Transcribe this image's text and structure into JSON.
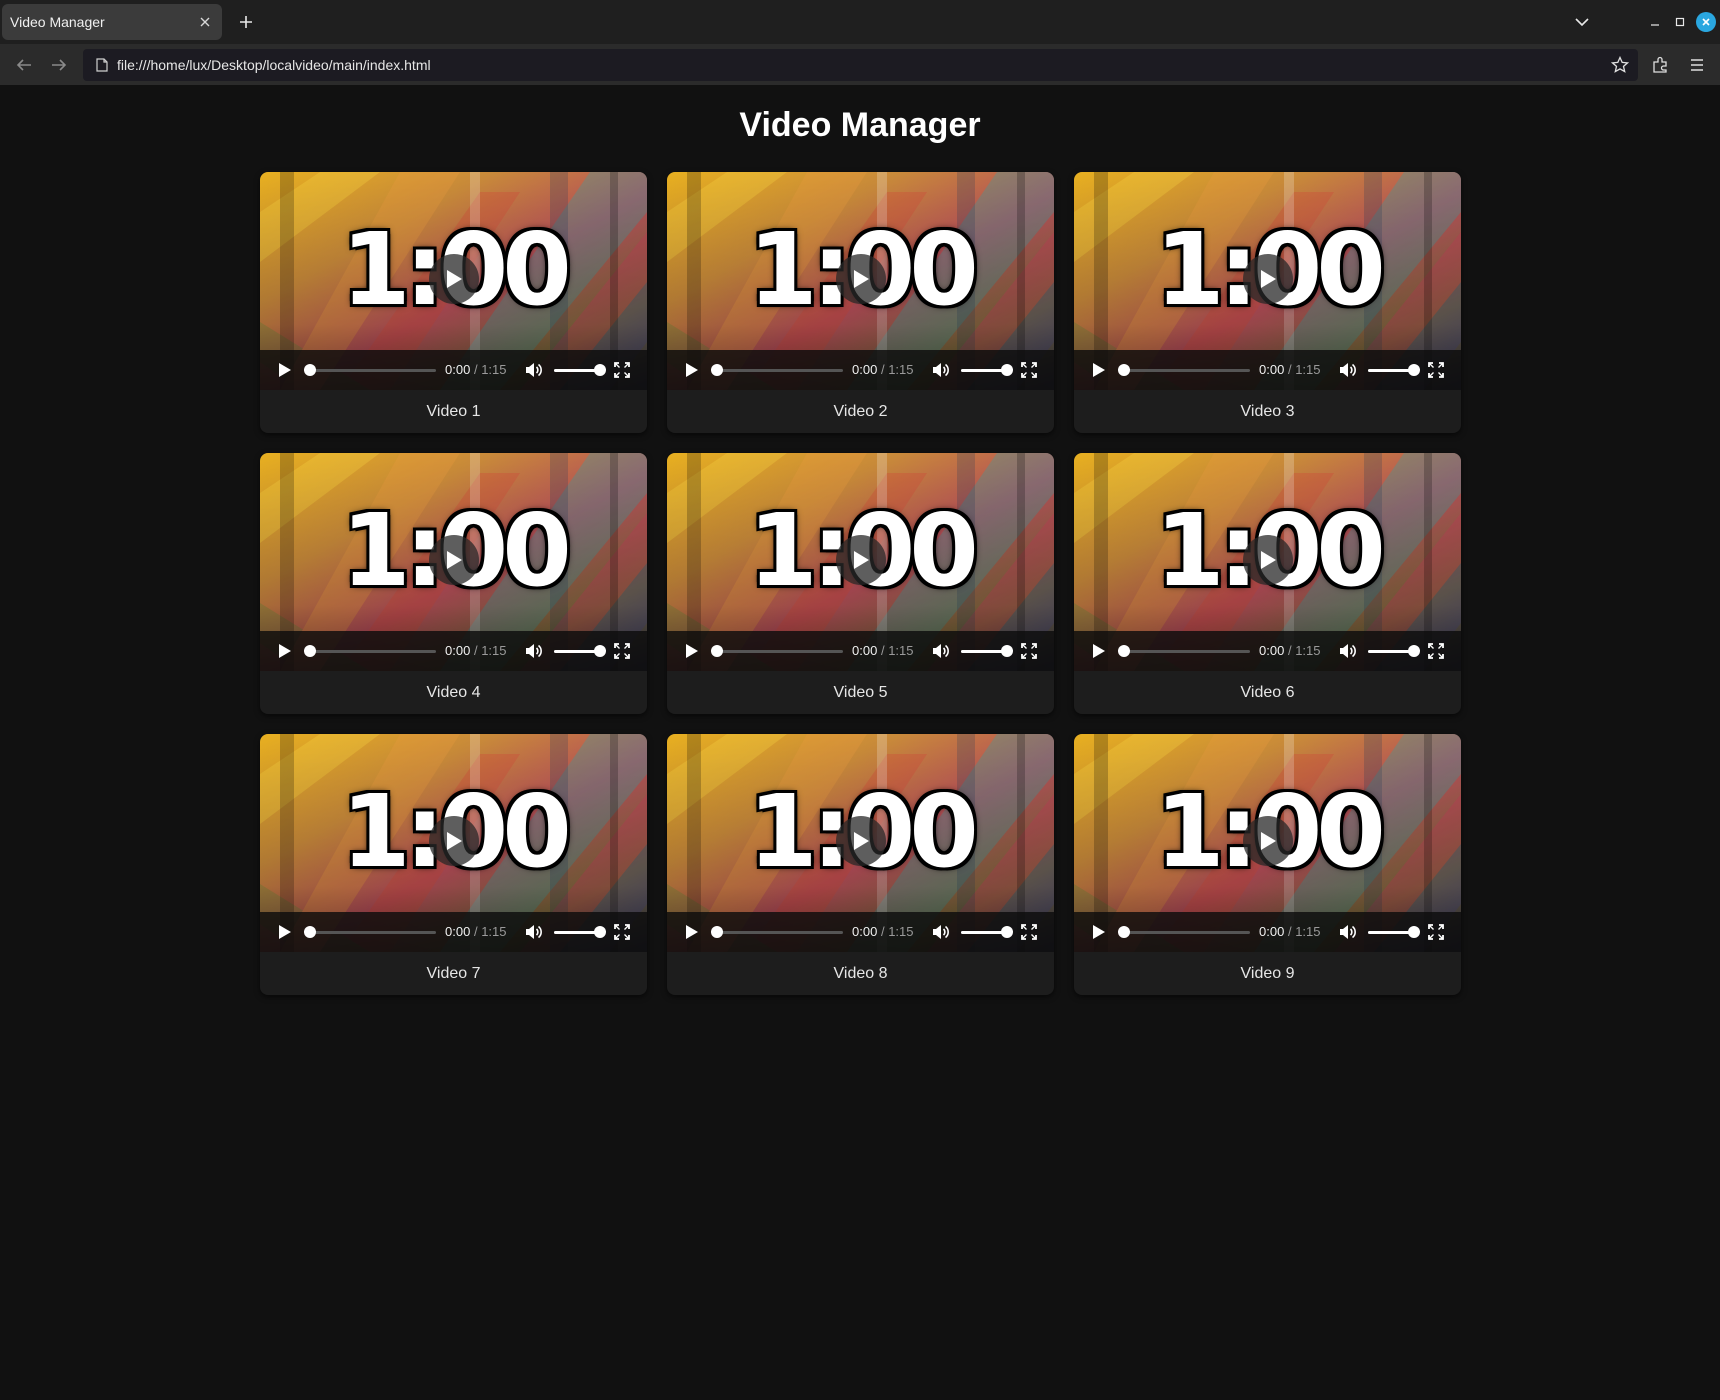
{
  "browser": {
    "tab_title": "Video Manager",
    "url": "file:///home/lux/Desktop/localvideo/main/index.html",
    "icons": [
      "close-icon",
      "plus-icon",
      "chevron-down-icon",
      "minimize-icon",
      "maximize-icon",
      "window-close-icon",
      "back-arrow-icon",
      "forward-arrow-icon",
      "page-icon",
      "star-icon",
      "extensions-icon",
      "menu-icon"
    ]
  },
  "page": {
    "title": "Video Manager"
  },
  "videos": [
    {
      "title": "Video 1",
      "thumb_text": "1:00",
      "current": "0:00",
      "duration": "1:15",
      "progress": 0,
      "volume": 1.0
    },
    {
      "title": "Video 2",
      "thumb_text": "1:00",
      "current": "0:00",
      "duration": "1:15",
      "progress": 0,
      "volume": 1.0
    },
    {
      "title": "Video 3",
      "thumb_text": "1:00",
      "current": "0:00",
      "duration": "1:15",
      "progress": 0,
      "volume": 1.0
    },
    {
      "title": "Video 4",
      "thumb_text": "1:00",
      "current": "0:00",
      "duration": "1:15",
      "progress": 0,
      "volume": 1.0
    },
    {
      "title": "Video 5",
      "thumb_text": "1:00",
      "current": "0:00",
      "duration": "1:15",
      "progress": 0,
      "volume": 1.0
    },
    {
      "title": "Video 6",
      "thumb_text": "1:00",
      "current": "0:00",
      "duration": "1:15",
      "progress": 0,
      "volume": 1.0
    },
    {
      "title": "Video 7",
      "thumb_text": "1:00",
      "current": "0:00",
      "duration": "1:15",
      "progress": 0,
      "volume": 1.0
    },
    {
      "title": "Video 8",
      "thumb_text": "1:00",
      "current": "0:00",
      "duration": "1:15",
      "progress": 0,
      "volume": 1.0
    },
    {
      "title": "Video 9",
      "thumb_text": "1:00",
      "current": "0:00",
      "duration": "1:15",
      "progress": 0,
      "volume": 1.0
    }
  ],
  "player_icons": [
    "play-icon",
    "mute-icon",
    "fullscreen-icon"
  ],
  "time_separator": "/",
  "colors": {
    "page_bg": "#111111",
    "card_bg": "#1d1d1d",
    "accent_close": "#2aa7e0"
  }
}
